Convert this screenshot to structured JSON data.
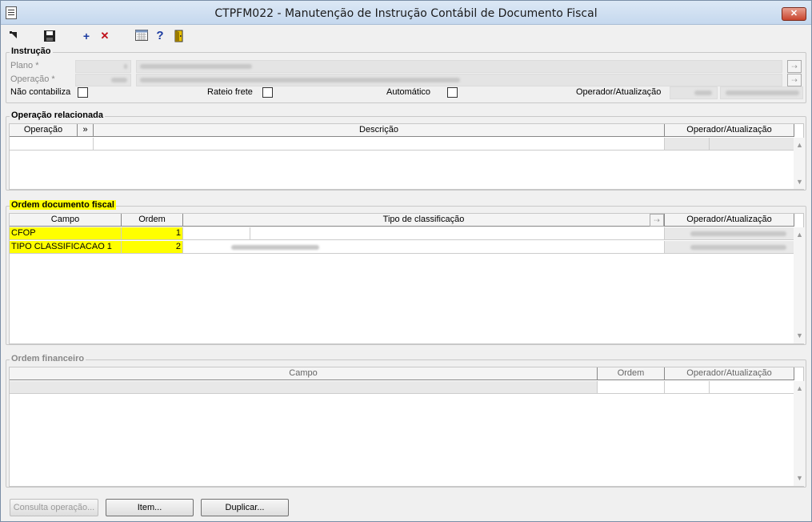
{
  "window": {
    "title": "CTPFM022 - Manutenção de Instrução Contábil de Documento Fiscal",
    "close_label": "✕"
  },
  "toolbar": {
    "add_label": "+",
    "delete_label": "✕",
    "help_label": "?"
  },
  "instrucao": {
    "legend": "Instrução",
    "plano_label": "Plano *",
    "operacao_label": "Operação *",
    "nao_contabiliza_label": "Não contabiliza",
    "rateio_frete_label": "Rateio frete",
    "automatico_label": "Automático",
    "operador_label": "Operador/Atualização"
  },
  "operacao_relacionada": {
    "legend": "Operação relacionada",
    "columns": [
      "Operação",
      "»",
      "Descrição",
      "Operador/Atualização"
    ]
  },
  "ordem_documento_fiscal": {
    "legend": "Ordem documento fiscal",
    "columns": [
      "Campo",
      "Ordem",
      "Tipo de classificação",
      "Operador/Atualização"
    ],
    "rows": [
      {
        "campo": "CFOP",
        "ordem": "1"
      },
      {
        "campo": "TIPO CLASSIFICACAO 1",
        "ordem": "2"
      }
    ]
  },
  "ordem_financeiro": {
    "legend": "Ordem financeiro",
    "columns": [
      "Campo",
      "Ordem",
      "Operador/Atualização"
    ]
  },
  "buttons": {
    "consulta": "Consulta operação...",
    "item": "Item...",
    "duplicar": "Duplicar..."
  },
  "colors": {
    "highlight": "#ffff00",
    "close": "#c9452d"
  }
}
